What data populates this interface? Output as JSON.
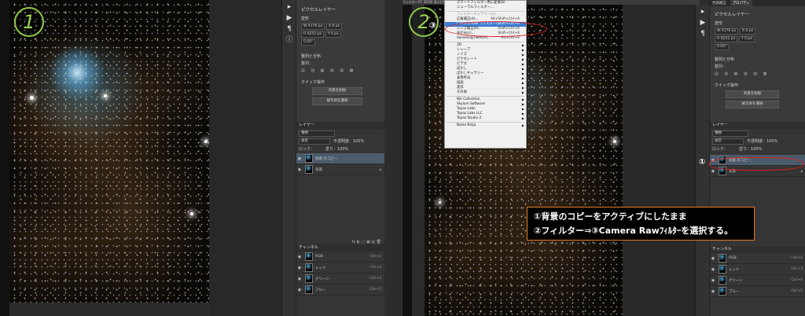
{
  "panel1": {
    "step": "1",
    "properties": {
      "title": "ピクセルレイヤー",
      "transform": "変形",
      "w": "W 4176 px",
      "h": "H 6252 px",
      "x": "X 0 px",
      "y": "Y 0 px",
      "angle": "0.00°",
      "align": "整列と分布",
      "align_sub": "整列：",
      "quick": "クイック操作",
      "btn_remove_bg": "背景を削除",
      "btn_select_subject": "被写体を選択"
    },
    "layers": {
      "header": "レイヤー",
      "search": "種類",
      "blend": "通常",
      "opacity": "不透明度：100%",
      "lock": "ロック：",
      "fill": "塗り：100%",
      "rows": [
        {
          "name": "背景 のコピー",
          "selected": true
        },
        {
          "name": "背景",
          "selected": false
        }
      ]
    },
    "channels": {
      "header": "チャンネル",
      "rows": [
        {
          "name": "RGB",
          "shortcut": "Ctrl+2"
        },
        {
          "name": "レッド",
          "shortcut": "Ctrl+3"
        },
        {
          "name": "グリーン",
          "shortcut": "Ctrl+4"
        },
        {
          "name": "ブルー",
          "shortcut": "Ctrl+5"
        }
      ]
    }
  },
  "panel2": {
    "step": "2",
    "menubar": "フィルター(T)   3D(D)   表示(V)   ウィンドウ(W)   ヘルプ(H)",
    "tabs": [
      "色調補正",
      "プロパティ"
    ],
    "menu": {
      "items": [
        {
          "label": "スマートフィルター用に変換(S)",
          "shortcut": "",
          "arrow": false,
          "disabled": false
        },
        {
          "label": "ニューラルフィルター...",
          "shortcut": "",
          "arrow": false,
          "disabled": false
        },
        {
          "sep": true
        },
        {
          "label": "フィルターギャラリー(G)...",
          "shortcut": "",
          "arrow": false,
          "disabled": true
        },
        {
          "label": "広角補正(A)...",
          "shortcut": "Alt+Shift+Ctrl+A",
          "arrow": false,
          "disabled": false
        },
        {
          "label": "Camera Raw フィルター(C)...",
          "shortcut": "Shift+Ctrl+A",
          "arrow": false,
          "disabled": false,
          "highlight": true
        },
        {
          "label": "レンズ補正(R)...",
          "shortcut": "Shift+Ctrl+R",
          "arrow": false,
          "disabled": false
        },
        {
          "label": "ゆがみ(L)...",
          "shortcut": "Shift+Ctrl+X",
          "arrow": false,
          "disabled": false
        },
        {
          "label": "Vanishing Point(V)...",
          "shortcut": "Alt+Ctrl+V",
          "arrow": false,
          "disabled": false
        },
        {
          "sep": true
        },
        {
          "label": "3D",
          "shortcut": "",
          "arrow": true
        },
        {
          "label": "シャープ",
          "shortcut": "",
          "arrow": true
        },
        {
          "label": "ノイズ",
          "shortcut": "",
          "arrow": true
        },
        {
          "label": "ピクセレート",
          "shortcut": "",
          "arrow": true
        },
        {
          "label": "ビデオ",
          "shortcut": "",
          "arrow": true
        },
        {
          "label": "ぼかし",
          "shortcut": "",
          "arrow": true
        },
        {
          "label": "ぼかしギャラリー",
          "shortcut": "",
          "arrow": true
        },
        {
          "label": "表現手法",
          "shortcut": "",
          "arrow": true
        },
        {
          "label": "描画",
          "shortcut": "",
          "arrow": true
        },
        {
          "label": "変形",
          "shortcut": "",
          "arrow": true
        },
        {
          "label": "その他",
          "shortcut": "",
          "arrow": true
        },
        {
          "sep": true
        },
        {
          "label": "Nik Collection",
          "shortcut": "",
          "arrow": true
        },
        {
          "label": "Skylum Software",
          "shortcut": "",
          "arrow": true
        },
        {
          "label": "Topaz Labs",
          "shortcut": "",
          "arrow": true
        },
        {
          "label": "Topaz Labs LLC",
          "shortcut": "",
          "arrow": true
        },
        {
          "label": "Topaz Studio 2",
          "shortcut": "",
          "arrow": true
        },
        {
          "sep": true
        },
        {
          "label": "Noise Ninja",
          "shortcut": "",
          "arrow": true
        }
      ]
    },
    "mark3": "③",
    "mark1": "①",
    "callout": {
      "line1": "①背景のコピーをアクティブにしたまま",
      "line2": "②フィルター⇒③Camera Rawﾌｨﾙﾀｰを選択する。"
    }
  },
  "colors": {
    "step_ring": "#8fc94a",
    "callout_border": "#e07a2a",
    "highlight_ring": "#e02020",
    "menu_highlight": "#3b7bd4"
  }
}
